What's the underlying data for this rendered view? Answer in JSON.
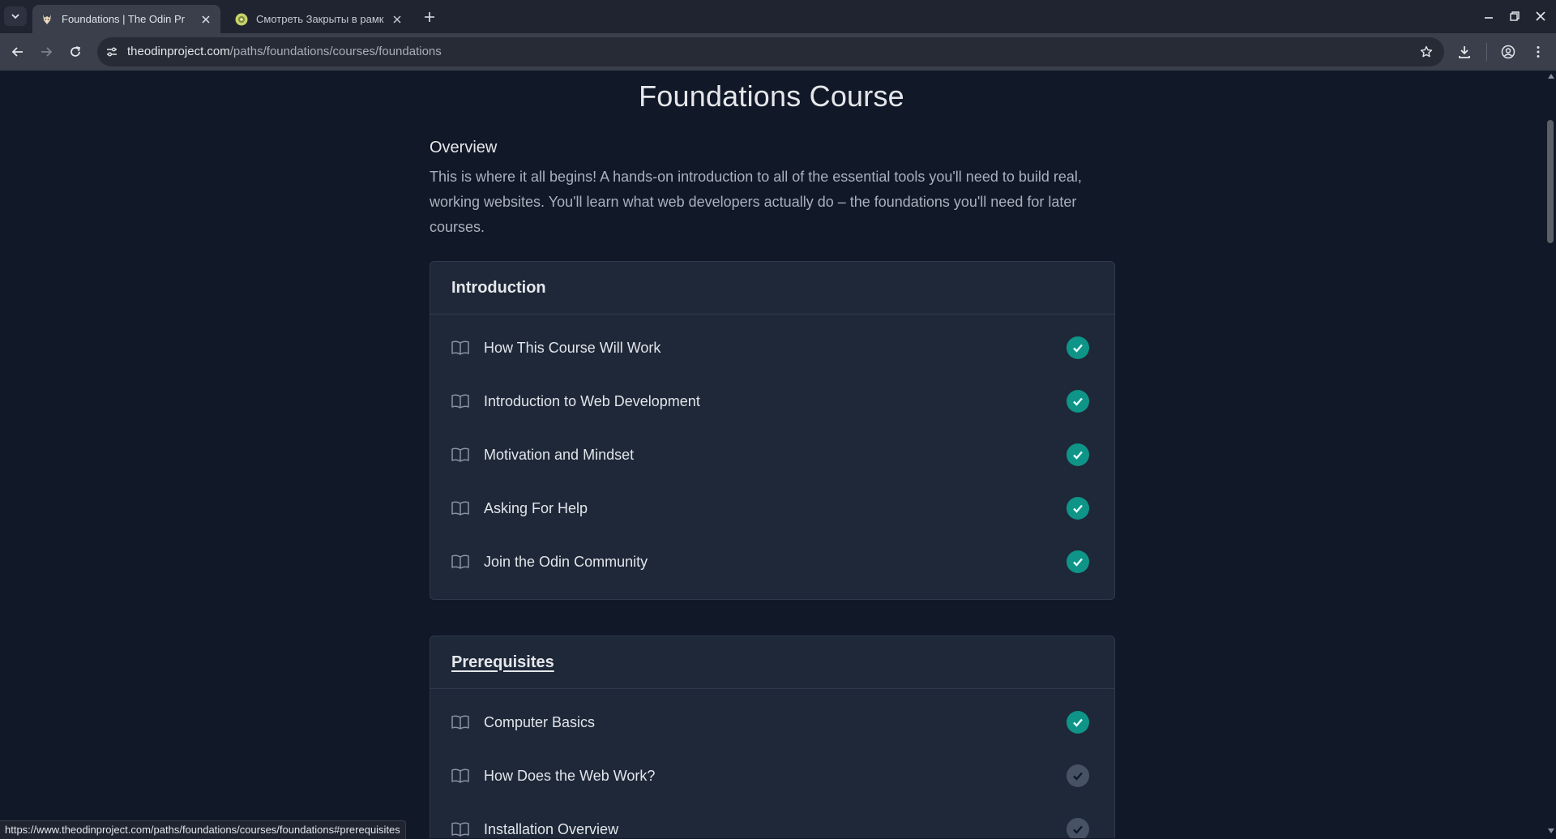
{
  "browser": {
    "tabs": [
      {
        "title": "Foundations | The Odin Pr",
        "active": true
      },
      {
        "title": "Смотреть Закрыты в рамк",
        "active": false
      }
    ],
    "url_domain": "theodinproject.com",
    "url_path": "/paths/foundations/courses/foundations",
    "status_url": "https://www.theodinproject.com/paths/foundations/courses/foundations#prerequisites"
  },
  "page": {
    "title": "Foundations Course",
    "overview_heading": "Overview",
    "overview_text": "This is where it all begins! A hands-on introduction to all of the essential tools you'll need to build real, working websites. You'll learn what web developers actually do – the foundations you'll need for later courses."
  },
  "sections": [
    {
      "title": "Introduction",
      "lessons": [
        {
          "label": "How This Course Will Work",
          "completed": true
        },
        {
          "label": "Introduction to Web Development",
          "completed": true
        },
        {
          "label": "Motivation and Mindset",
          "completed": true
        },
        {
          "label": "Asking For Help",
          "completed": true
        },
        {
          "label": "Join the Odin Community",
          "completed": true
        }
      ]
    },
    {
      "title": "Prerequisites",
      "lessons": [
        {
          "label": "Computer Basics",
          "completed": true
        },
        {
          "label": "How Does the Web Work?",
          "completed": false
        },
        {
          "label": "Installation Overview",
          "completed": false
        }
      ]
    }
  ],
  "colors": {
    "background": "#111827",
    "card": "#1e2838",
    "check_done": "#0f9488",
    "check_todo": "#475264"
  },
  "icons": {
    "lesson_icon": "book-icon",
    "status_icon": "check-circle-icon"
  }
}
